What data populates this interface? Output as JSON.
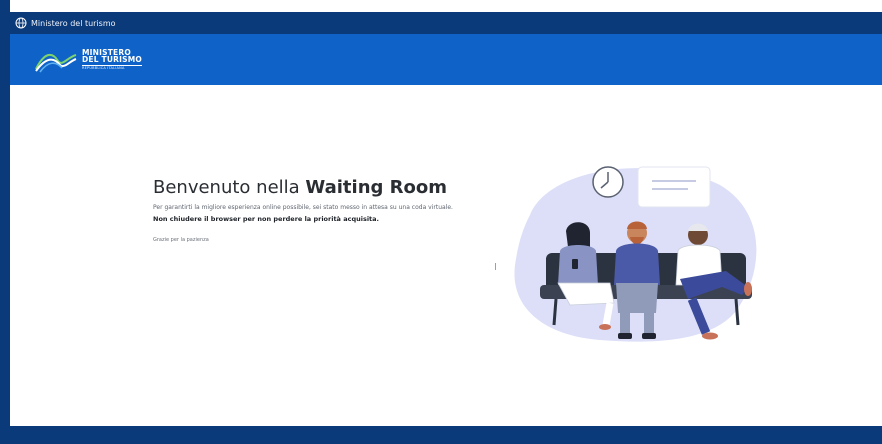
{
  "topbar": {
    "government_name": "Ministero del turismo"
  },
  "header": {
    "logo": {
      "line1": "MINISTERO",
      "line2": "DEL TURISMO",
      "line3": "REPUBBLICA ITALIANA"
    }
  },
  "main": {
    "title_prefix": "Benvenuto nella ",
    "title_emphasis": "Waiting Room",
    "intro": "Per garantirti la migliore esperienza online possibile, sei stato messo in attesa su una coda virtuale.",
    "warning": "Non chiudere il browser per non perdere la priorità acquisita.",
    "thanks": "Grazie per la pazienza"
  },
  "colors": {
    "topbar": "#0b3a7a",
    "header": "#0f63c8",
    "footer": "#0b3a7a",
    "illustration_blob": "#dcdff7",
    "bench": "#2c3340"
  },
  "icons": {
    "topbar": "globe-icon",
    "header": "ministry-wave-logo-icon",
    "illustration": "waiting-room-illustration"
  }
}
